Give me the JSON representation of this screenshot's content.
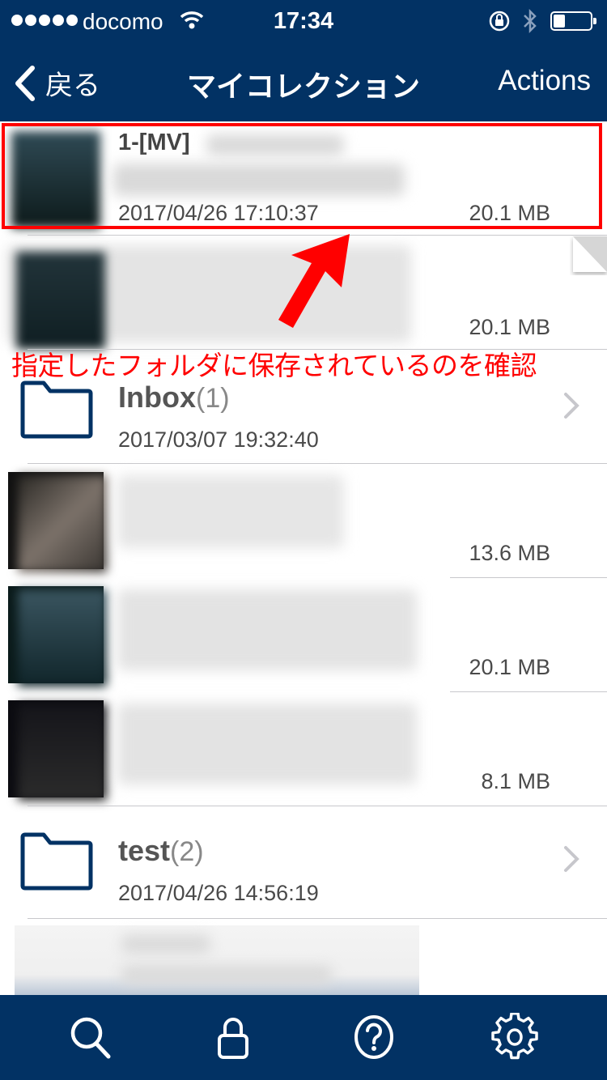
{
  "status_bar": {
    "carrier": "docomo",
    "time": "17:34",
    "signal_bars": 5,
    "battery_level_percent": 30,
    "icons": [
      "signal-dots-icon",
      "wifi-icon",
      "rotation-lock-icon",
      "bluetooth-icon",
      "battery-icon"
    ]
  },
  "nav_bar": {
    "back_label": "戻る",
    "title": "マイコレクション",
    "actions_label": "Actions"
  },
  "items": [
    {
      "type": "file",
      "title_visible": "1-[MV]",
      "date": "2017/04/26 17:10:37",
      "size": "20.1 MB",
      "highlighted": true
    },
    {
      "type": "file",
      "title_visible": "",
      "date": "",
      "size": "20.1 MB",
      "highlighted": false
    },
    {
      "type": "folder",
      "name": "Inbox",
      "count": "(1)",
      "date": "2017/03/07 19:32:40"
    },
    {
      "type": "file",
      "title_visible": "",
      "date": "",
      "size": "13.6 MB"
    },
    {
      "type": "file",
      "title_visible": "",
      "date": "",
      "size": "20.1 MB"
    },
    {
      "type": "file",
      "title_visible": "",
      "date": "",
      "size": "8.1 MB"
    },
    {
      "type": "folder",
      "name": "test",
      "count": "(2)",
      "date": "2017/04/26 14:56:19"
    },
    {
      "type": "file",
      "title_visible": "",
      "date": "",
      "size": ""
    }
  ],
  "annotation": {
    "text": "指定したフォルダに保存されているのを確認",
    "color": "#ff0000"
  },
  "tab_bar": {
    "tabs": [
      {
        "name": "search",
        "icon": "search-icon"
      },
      {
        "name": "lock",
        "icon": "lock-icon"
      },
      {
        "name": "help",
        "icon": "help-icon"
      },
      {
        "name": "settings",
        "icon": "gear-icon"
      }
    ]
  },
  "colors": {
    "brand_navy": "#023264",
    "annotation_red": "#ff0000",
    "text_gray": "#4a4a4a"
  }
}
